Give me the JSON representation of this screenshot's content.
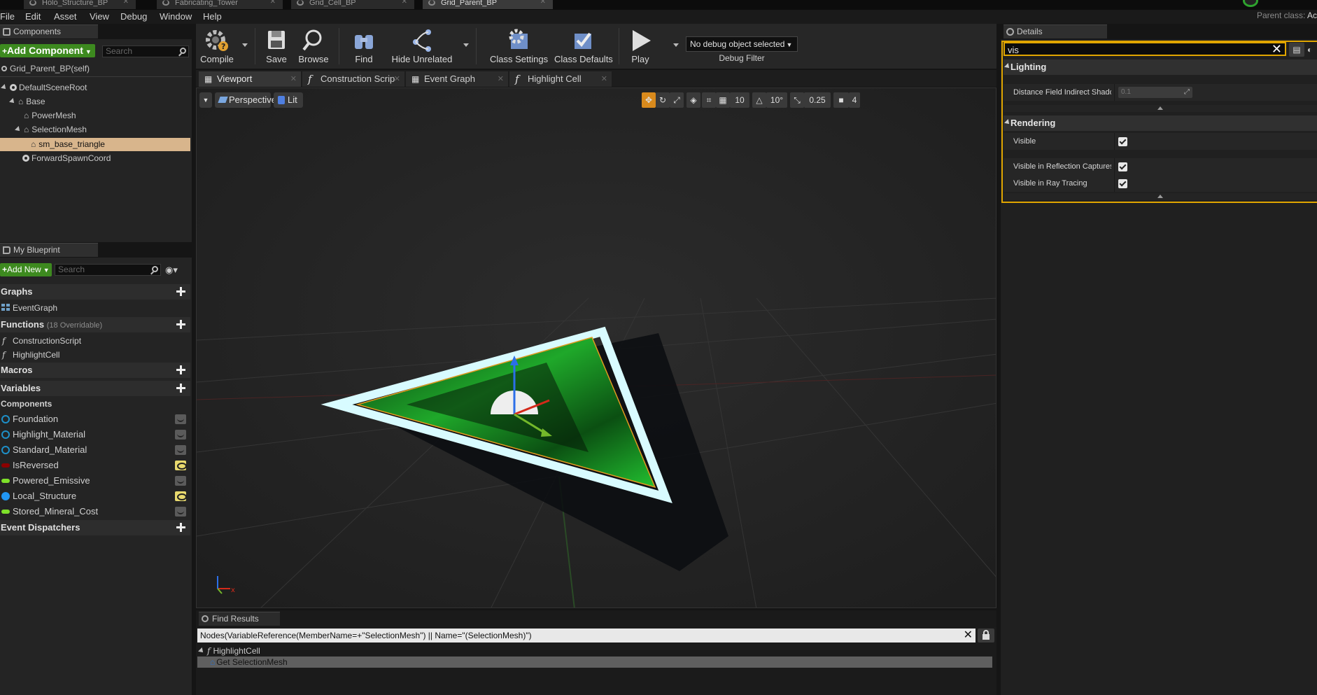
{
  "doc_tabs": [
    {
      "label": "Holo_Structure_BP"
    },
    {
      "label": "Fabricating_Tower"
    },
    {
      "label": "Grid_Cell_BP"
    },
    {
      "label": "Grid_Parent_BP"
    }
  ],
  "menu": [
    "File",
    "Edit",
    "Asset",
    "View",
    "Debug",
    "Window",
    "Help"
  ],
  "parent_class": {
    "label": "Parent class:",
    "value": "Ac"
  },
  "components_panel": {
    "tab": "Components",
    "add_button": "Add Component",
    "search_placeholder": "Search",
    "self_label": "Grid_Parent_BP(self)",
    "tree": [
      {
        "label": "DefaultSceneRoot"
      },
      {
        "label": "Base"
      },
      {
        "label": "PowerMesh"
      },
      {
        "label": "SelectionMesh"
      },
      {
        "label": "sm_base_triangle"
      },
      {
        "label": "ForwardSpawnCoord"
      }
    ]
  },
  "blueprint_panel": {
    "tab": "My Blueprint",
    "add_button": "Add New",
    "search_placeholder": "Search",
    "graphs_header": "Graphs",
    "graphs": [
      "EventGraph"
    ],
    "functions_header": "Functions",
    "functions_sub": "(18 Overridable)",
    "functions": [
      "ConstructionScript",
      "HighlightCell"
    ],
    "macros_header": "Macros",
    "variables_header": "Variables",
    "components_sub_header": "Components",
    "variables": [
      {
        "name": "Foundation",
        "color": "#1e90c8",
        "pin": "ring",
        "eye": false
      },
      {
        "name": "Highlight_Material",
        "color": "#1e90c8",
        "pin": "ring",
        "eye": false
      },
      {
        "name": "Standard_Material",
        "color": "#1e90c8",
        "pin": "ring",
        "eye": false
      },
      {
        "name": "IsReversed",
        "color": "#8c0000",
        "pin": "bar",
        "eye": true
      },
      {
        "name": "Powered_Emissive",
        "color": "#7ee02a",
        "pin": "bar",
        "eye": false
      },
      {
        "name": "Local_Structure",
        "color": "#2196f3",
        "pin": "dot",
        "eye": true
      },
      {
        "name": "Stored_Mineral_Cost",
        "color": "#7ee02a",
        "pin": "bar",
        "eye": false
      }
    ],
    "dispatchers_header": "Event Dispatchers"
  },
  "toolbar": {
    "compile": "Compile",
    "save": "Save",
    "browse": "Browse",
    "find": "Find",
    "hide_unrelated": "Hide Unrelated",
    "class_settings": "Class Settings",
    "class_defaults": "Class Defaults",
    "play": "Play",
    "debug_select": "No debug object selected",
    "debug_filter": "Debug Filter"
  },
  "editor_tabs": [
    "Viewport",
    "Construction Scrip",
    "Event Graph",
    "Highlight Cell"
  ],
  "viewport": {
    "perspective": "Perspective",
    "lit": "Lit",
    "grid_snap": "10",
    "rot_snap": "10°",
    "scale_snap": "0.25",
    "camera_speed": "4",
    "axis_x": "x"
  },
  "find_results": {
    "tab": "Find Results",
    "query": "Nodes(VariableReference(MemberName=+\"SelectionMesh\") || Name=\"(SelectionMesh)\")",
    "results": [
      {
        "label": "HighlightCell"
      },
      {
        "label": "Get SelectionMesh"
      }
    ]
  },
  "details": {
    "tab": "Details",
    "search_value": "vis",
    "lighting_header": "Lighting",
    "lighting_rows": [
      {
        "label": "Distance Field Indirect Shadow",
        "value": "0.1"
      }
    ],
    "rendering_header": "Rendering",
    "rendering_rows": [
      {
        "label": "Visible",
        "checked": true
      },
      {
        "label": "Visible in Reflection Captures",
        "checked": true
      },
      {
        "label": "Visible in Ray Tracing",
        "checked": true
      }
    ]
  }
}
